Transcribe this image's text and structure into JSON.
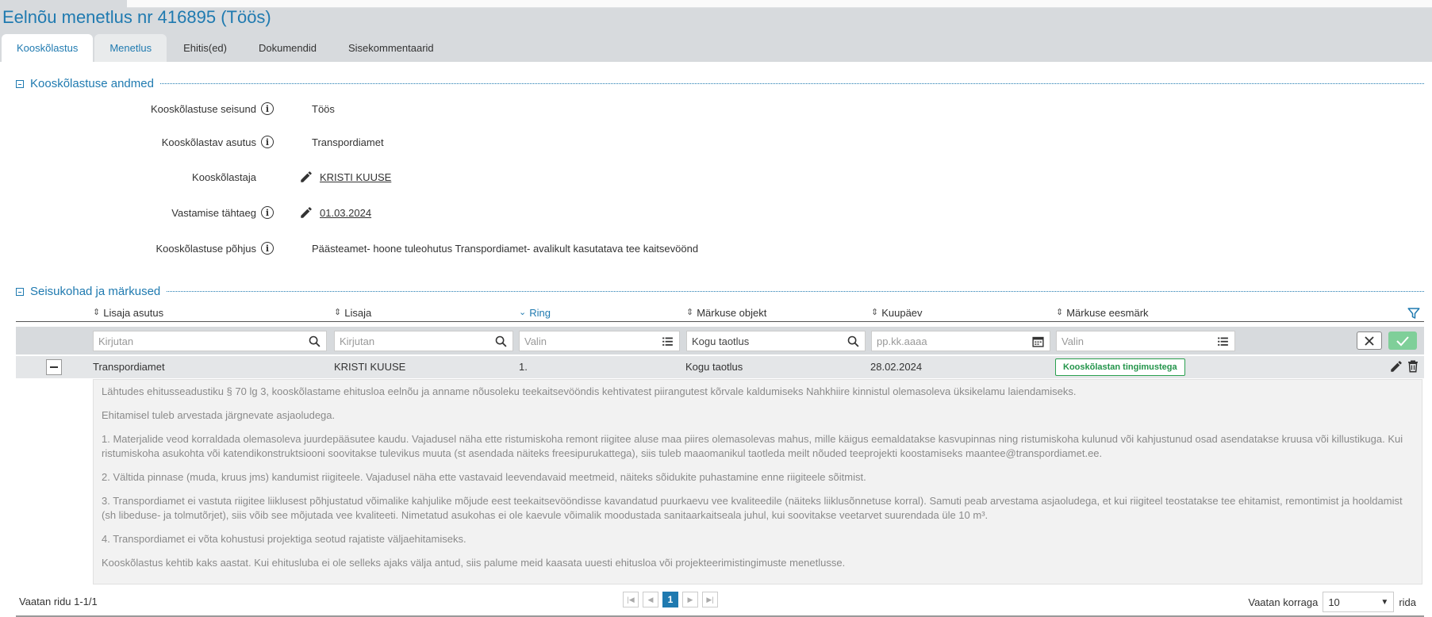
{
  "page": {
    "title": "Eelnõu menetlus nr 416895 (Töös)"
  },
  "tabs": [
    {
      "label": "Kooskõlastus"
    },
    {
      "label": "Menetlus"
    },
    {
      "label": "Ehitis(ed)"
    },
    {
      "label": "Dokumendid"
    },
    {
      "label": "Sisekommentaarid"
    }
  ],
  "section1": {
    "title": "Kooskõlastuse andmed",
    "fields": [
      {
        "label": "Kooskõlastuse seisund",
        "value": "Töös"
      },
      {
        "label": "Kooskõlastav asutus",
        "value": "Transpordiamet"
      },
      {
        "label": "Kooskõlastaja",
        "value": "KRISTI KUUSE"
      },
      {
        "label": "Vastamise tähtaeg",
        "value": "01.03.2024"
      },
      {
        "label": "Kooskõlastuse põhjus",
        "value": "Päästeamet- hoone tuleohutus Transpordiamet- avalikult kasutatava tee kaitsevöönd"
      }
    ]
  },
  "section2": {
    "title": "Seisukohad ja märkused"
  },
  "table": {
    "columns": [
      "Lisaja asutus",
      "Lisaja",
      "Ring",
      "Märkuse objekt",
      "Kuupäev",
      "Märkuse eesmärk"
    ],
    "filters": {
      "asutus_placeholder": "Kirjutan",
      "lisaja_placeholder": "Kirjutan",
      "ring_placeholder": "Valin",
      "objekt_value": "Kogu taotlus",
      "kuupaev_placeholder": "pp.kk.aaaa",
      "eesmark_placeholder": "Valin"
    },
    "row": {
      "asutus": "Transpordiamet",
      "lisaja": "KRISTI KUUSE",
      "ring": "1.",
      "objekt": "Kogu taotlus",
      "kuupaev": "28.02.2024",
      "eesmark": "Kooskõlastan tingimustega"
    },
    "comment": [
      "Lähtudes ehitusseadustiku § 70 lg 3, kooskõlastame ehitusloa eelnõu ja anname nõusoleku teekaitsevööndis kehtivatest piirangutest kõrvale kaldumiseks Nahkhiire kinnistul olemasoleva üksikelamu laiendamiseks.",
      "Ehitamisel tuleb arvestada järgnevate asjaoludega.",
      "1. Materjalide veod korraldada olemasoleva juurdepääsutee kaudu. Vajadusel näha ette ristumiskoha remont riigitee aluse maa piires olemasolevas mahus, mille käigus eemaldatakse kasvupinnas ning ristumiskoha kulunud või kahjustunud osad asendatakse kruusa või killustikuga. Kui ristumiskoha asukohta või katendikonstruktsiooni soovitakse tulevikus muuta (st asendada näiteks freesipurukattega), siis tuleb maaomanikul taotleda meilt nõuded teeprojekti koostamiseks maantee@transpordiamet.ee.",
      "2. Vältida pinnase (muda, kruus jms) kandumist riigiteele. Vajadusel näha ette vastavaid leevendavaid meetmeid, näiteks sõidukite puhastamine enne riigiteele sõitmist.",
      "3. Transpordiamet ei vastuta riigitee liiklusest põhjustatud võimalike kahjulike mõjude eest teekaitsevööndisse kavandatud puurkaevu vee kvaliteedile (näiteks liiklusõnnetuse korral). Samuti peab arvestama asjaoludega, et kui riigiteel teostatakse tee ehitamist, remontimist ja hooldamist (sh libeduse- ja tolmutõrjet), siis võib see mõjutada vee kvaliteeti. Nimetatud asukohas ei ole kaevule võimalik moodustada sanitaarkaitseala juhul, kui soovitakse veetarvet suurendada üle 10 m³.",
      "4. Transpordiamet ei võta kohustusi projektiga seotud rajatiste väljaehitamiseks.",
      "Kooskõlastus kehtib kaks aastat. Kui ehitusluba ei ole selleks ajaks välja antud, siis palume meid kaasata uuesti ehitusloa või projekteerimistingimuste menetlusse."
    ]
  },
  "footer": {
    "rows_info": "Vaatan ridu 1-1/1",
    "current_page": "1",
    "per_page_label": "Vaatan korraga",
    "per_page_value": "10",
    "per_page_suffix": "rida"
  },
  "colors": {
    "accent": "#1f7ab0",
    "success": "#23944a",
    "band": "#d7dadd"
  }
}
